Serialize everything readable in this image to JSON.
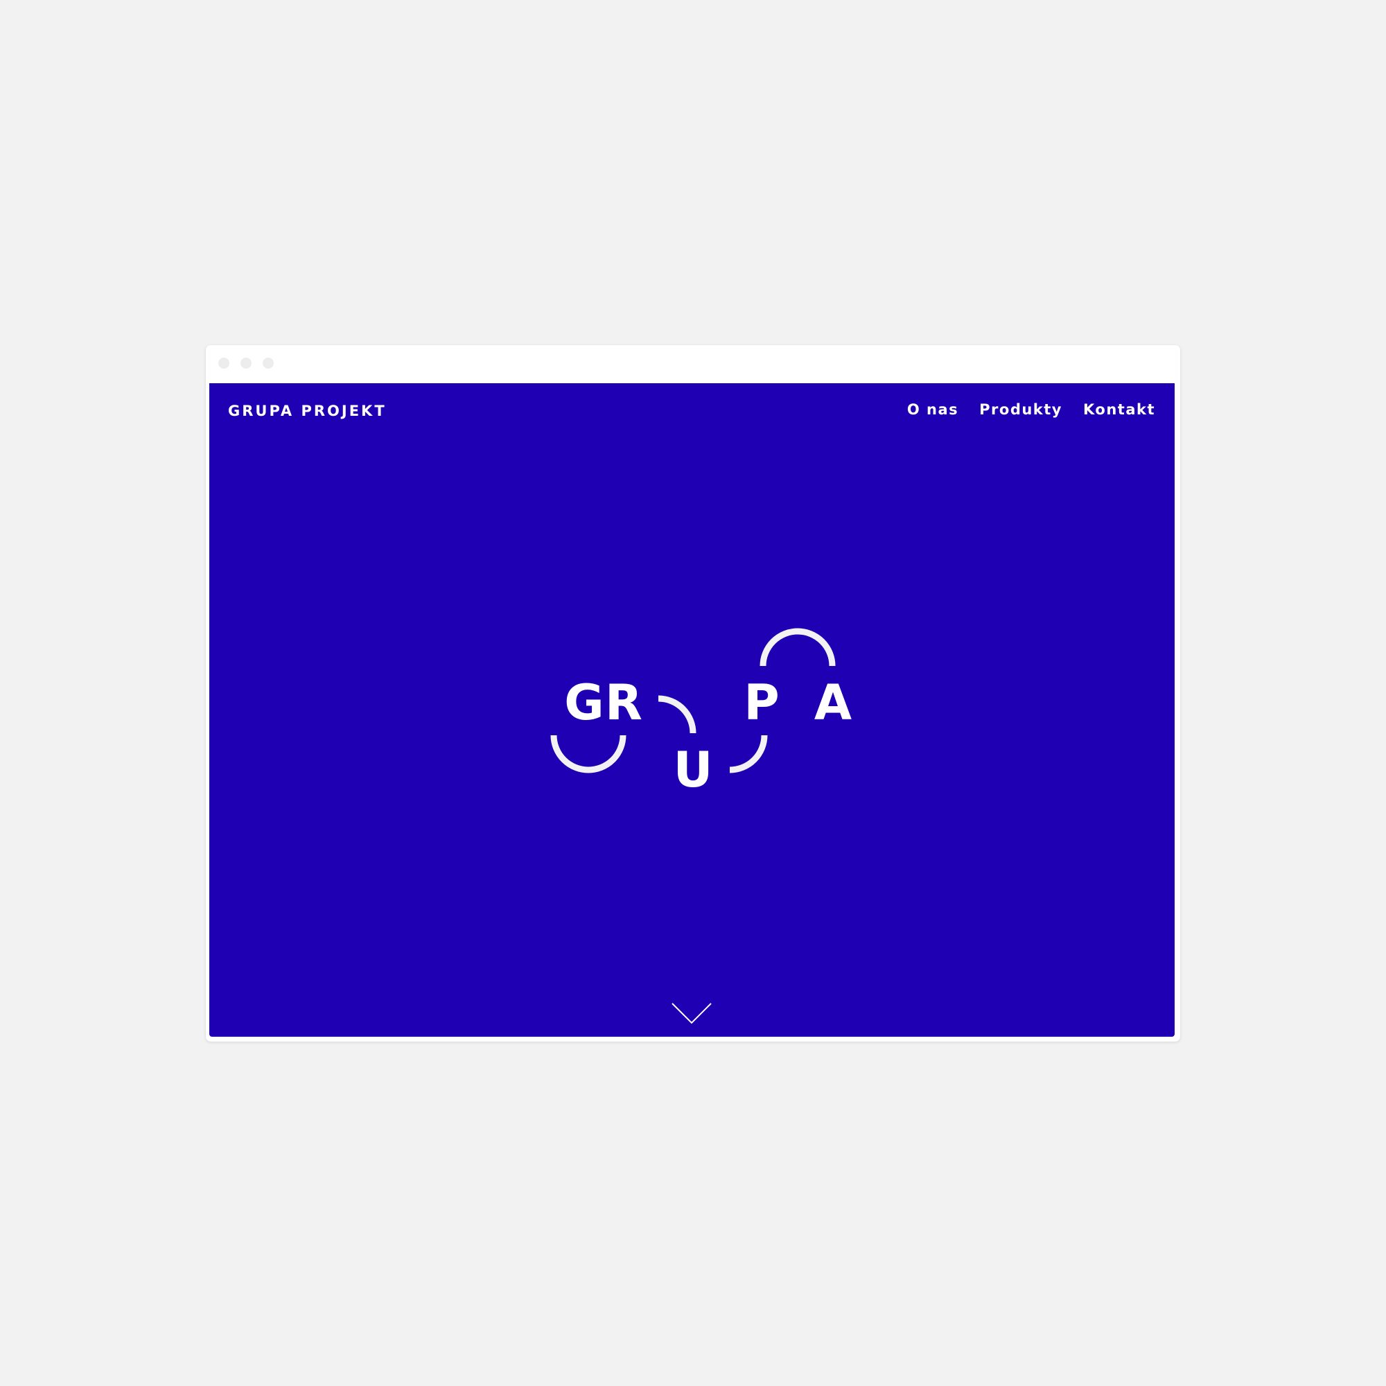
{
  "brand": "GRUPA PROJEKT",
  "nav": [
    {
      "label": "O nas"
    },
    {
      "label": "Produkty"
    },
    {
      "label": "Kontakt"
    }
  ],
  "hero": {
    "letters": [
      "G",
      "R",
      "U",
      "P",
      "A"
    ]
  },
  "colors": {
    "background": "#f2f2f2",
    "accent": "#1f00b3",
    "foreground": "#ffffff"
  },
  "icons": {
    "scroll_down": "chevron-down-icon"
  }
}
